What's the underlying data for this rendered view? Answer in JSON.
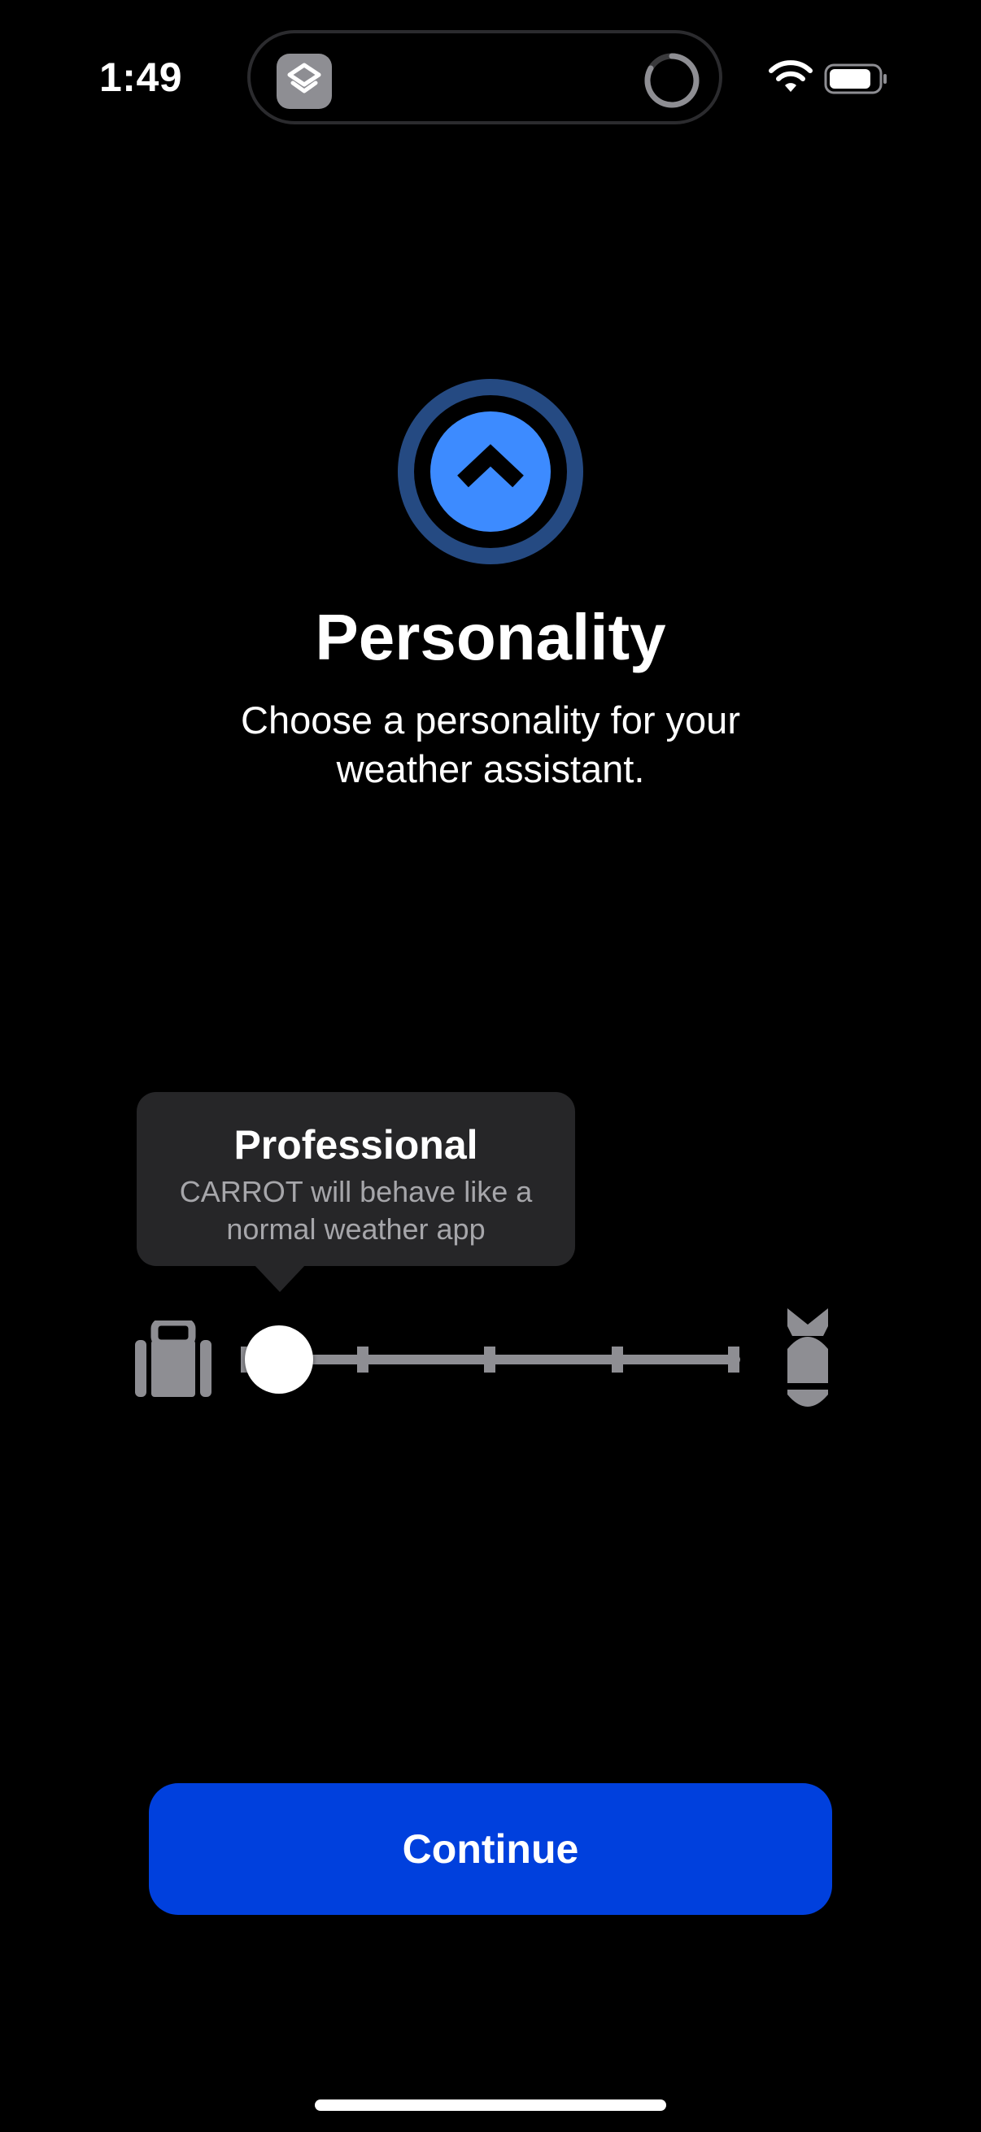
{
  "status_bar": {
    "time": "1:49",
    "icons": [
      "shortcuts-app-icon",
      "loading-spinner-icon",
      "wifi-icon",
      "battery-icon"
    ]
  },
  "header": {
    "icon": "personality-chevron-up-icon",
    "title": "Personality",
    "subtitle": "Choose a personality for your weather assistant."
  },
  "tooltip": {
    "title": "Professional",
    "description": "CARROT will behave like a normal weather app"
  },
  "slider": {
    "left_icon": "briefcase-icon",
    "right_icon": "bomb-icon",
    "steps": 5,
    "selected_index": 0,
    "value_fraction": 0.0
  },
  "continue_button": {
    "label": "Continue"
  },
  "colors": {
    "background": "#000000",
    "accent_blue": "#0040DD",
    "icon_blue": "#3D8BFF",
    "icon_ring": "#254A82",
    "tooltip_bg": "#262628",
    "slider_gray": "#8E8E93"
  }
}
